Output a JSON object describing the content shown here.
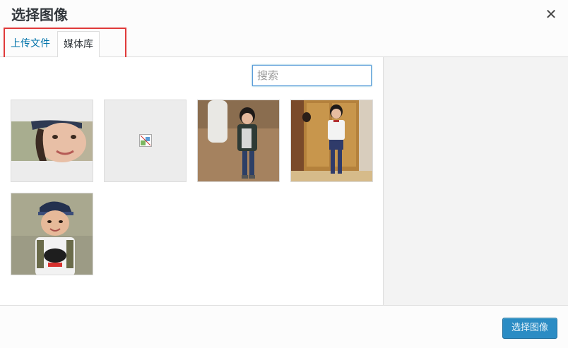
{
  "header": {
    "title": "选择图像",
    "close_icon": "close-icon"
  },
  "tabs": [
    {
      "label": "上传文件"
    },
    {
      "label": "媒体库",
      "active": true
    }
  ],
  "search": {
    "placeholder": "搜索",
    "value": ""
  },
  "media": [
    {
      "kind": "photo",
      "subject": "girl-face-closeup"
    },
    {
      "kind": "broken-image",
      "icon": "broken-image-icon"
    },
    {
      "kind": "photo",
      "subject": "girl-outdoor-dirt"
    },
    {
      "kind": "photo",
      "subject": "girl-indoor-door"
    },
    {
      "kind": "photo",
      "subject": "child-with-cap"
    }
  ],
  "footer": {
    "select_label": "选择图像"
  },
  "colors": {
    "accent": "#0073aa",
    "button": "#2b8cc4",
    "highlight": "#e03a3a"
  }
}
